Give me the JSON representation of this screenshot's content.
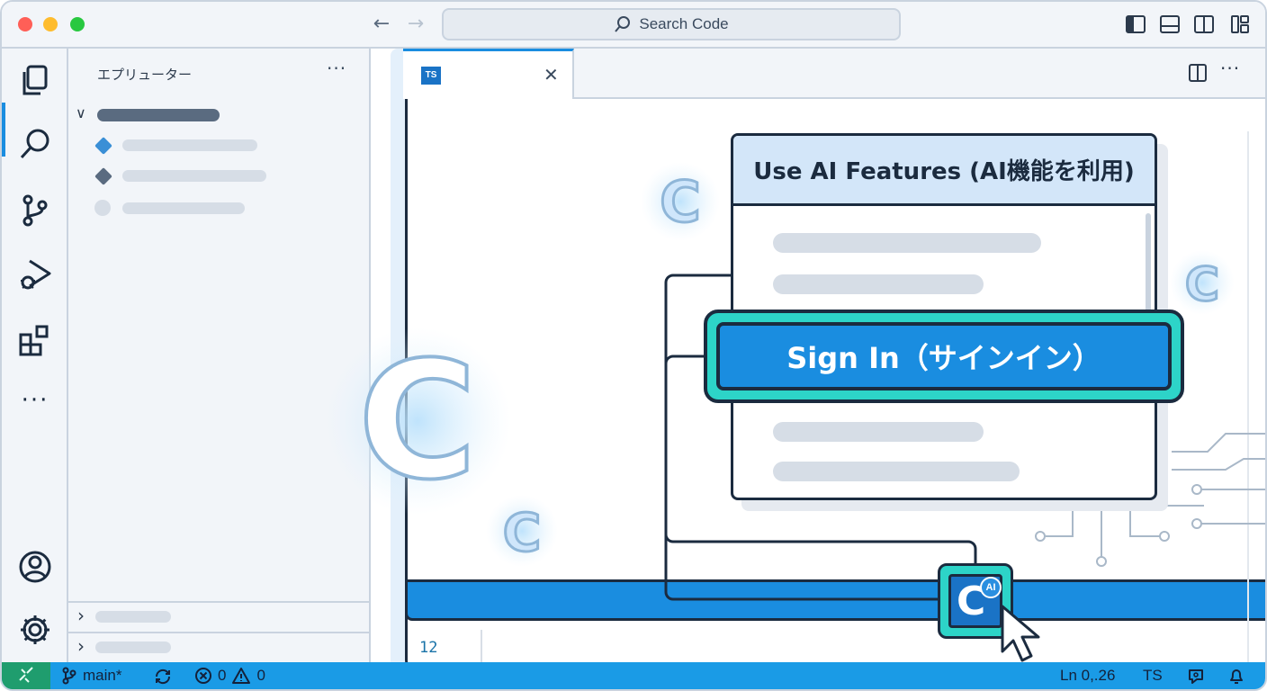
{
  "window": {
    "title": ""
  },
  "titlebar": {
    "search_placeholder": "Search Code",
    "icons": [
      "arrow-left-icon",
      "arrow-right-icon",
      "search-icon",
      "toggle-primary-sidebar-icon",
      "toggle-panel-icon",
      "toggle-secondary-sidebar-icon",
      "customize-layout-icon"
    ]
  },
  "activity_bar": {
    "items": [
      "explorer-icon",
      "search-icon",
      "source-control-icon",
      "run-debug-icon",
      "extensions-icon",
      "more-icon"
    ],
    "more_label": "···",
    "bottom": [
      "account-icon",
      "settings-gear-icon"
    ]
  },
  "sidebar": {
    "title": "エプリューター",
    "more_label": "···",
    "collapse_symbol": "∨",
    "expand_symbol": "›"
  },
  "editor": {
    "tab": {
      "badge": "TS",
      "close_symbol": "✕"
    },
    "line_number": "12"
  },
  "dialog": {
    "title": "Use AI Features (AI機能を利用)",
    "signin_label": "Sign In（サインイン）"
  },
  "copilot": {
    "letter": "C",
    "badge": "AI"
  },
  "decor": {
    "glow_letter": "C"
  },
  "statusbar": {
    "branch": "main*",
    "errors": "0",
    "warnings": "0",
    "position": "Ln 0,.26",
    "language": "TS"
  },
  "colors": {
    "accent": "#1a8de0",
    "teal": "#2dd4c8",
    "outline": "#1b2b3f",
    "status_bar": "#1a9be6",
    "remote": "#1f9d6e"
  }
}
